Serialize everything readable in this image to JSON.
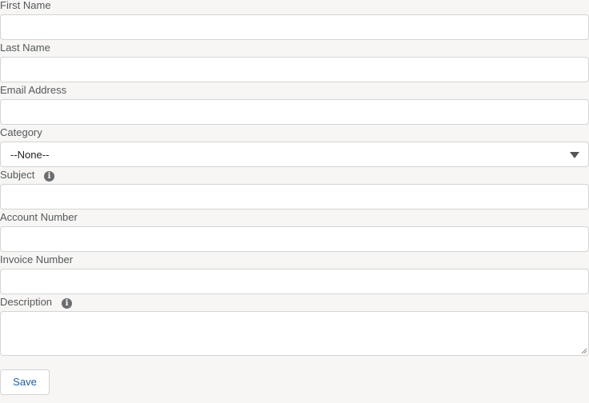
{
  "form": {
    "fields": [
      {
        "label": "First Name",
        "value": ""
      },
      {
        "label": "Last Name",
        "value": ""
      },
      {
        "label": "Email Address",
        "value": ""
      },
      {
        "label": "Category",
        "value": "--None--"
      },
      {
        "label": "Subject",
        "value": ""
      },
      {
        "label": "Account Number",
        "value": ""
      },
      {
        "label": "Invoice Number",
        "value": ""
      },
      {
        "label": "Description",
        "value": ""
      }
    ],
    "info_icon_glyph": "i",
    "save_label": "Save"
  },
  "colors": {
    "background": "#f7f6f4",
    "label_text": "#54585b",
    "border": "#d4d4d4",
    "button_text": "#1b5fae",
    "info_icon": "#6b6d70"
  },
  "icons": [
    "info-icon",
    "chevron-down-icon",
    "resize-grip-icon"
  ]
}
